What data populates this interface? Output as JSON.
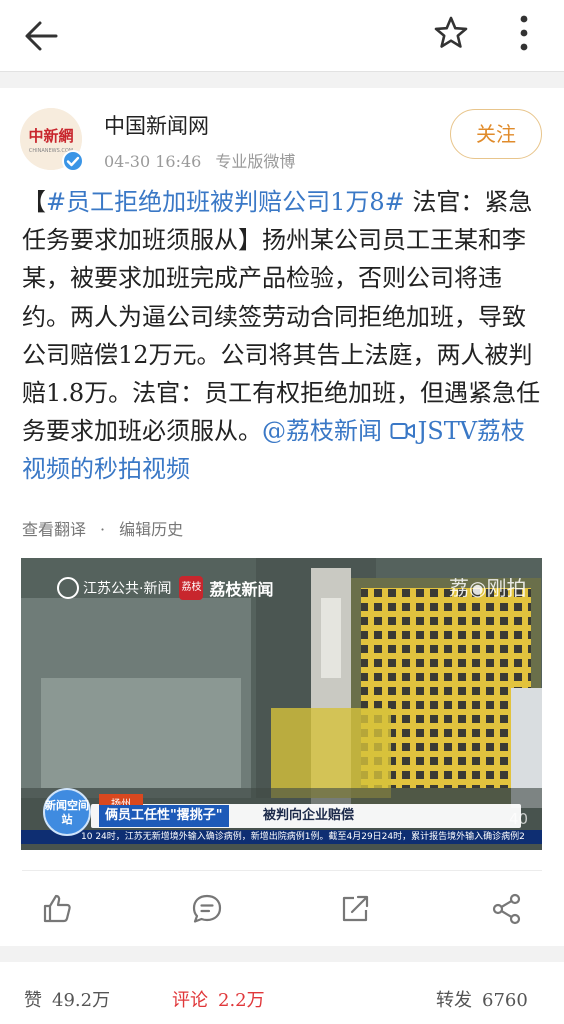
{
  "header": {
    "back_icon": "arrow-left-icon",
    "favorite_icon": "star-icon",
    "more_icon": "more-vertical-icon"
  },
  "post": {
    "author": "中国新闻网",
    "avatar_text": "中新網",
    "avatar_subtext": "CHINANEWS.COM",
    "timestamp": "04-30 16:46",
    "source": "专业版微博",
    "follow_label": "关注",
    "text_open": "【",
    "hashtag": "#员工拒绝加班被判赔公司1万8#",
    "text_body": " 法官：紧急任务要求加班须服从】扬州某公司员工王某和李某，被要求加班完成产品检验，否则公司将违约。两人为逼公司续签劳动合同拒绝加班，导致公司赔偿12万元。公司将其告上法庭，两人被判赔1.8万。法官：员工有权拒绝加班，但遇紧急任务要求加班必须服从。",
    "mention": "@荔枝新闻",
    "video_link": "JSTV荔枝视频的秒拍视频",
    "translate_label": "查看翻译",
    "separator": "·",
    "edit_history_label": "编辑历史"
  },
  "video": {
    "watermark_left": "江苏公共·新闻",
    "watermark_litchi_logo": "荔枝",
    "watermark_litchi": "荔枝新闻",
    "watermark_right": "荔◉刚拍",
    "badge": "新闻空间站",
    "lower_tag": "扬州",
    "lower_title": "俩员工任性\"撂挑子\"",
    "lower_title2": "被判向企业赔偿",
    "ticker": "10 24时，江苏无新增境外输入确诊病例，新增出院病例1例。截至4月29日24时，累计报告境外输入确诊病例2",
    "timecode": "40"
  },
  "actions": {
    "like_icon": "thumbs-up-icon",
    "comment_icon": "comment-icon",
    "repost_icon": "share-arrow-icon",
    "share_icon": "share-nodes-icon"
  },
  "stats": {
    "likes_label": "赞",
    "likes_count": "49.2万",
    "comments_label": "评论",
    "comments_count": "2.2万",
    "reposts_label": "转发",
    "reposts_count": "6760"
  },
  "colors": {
    "accent_link": "#3a78c6",
    "follow_text": "#e08b2b",
    "follow_border": "#e8c58c",
    "active_tab": "#e0373a",
    "verified": "#3a95e6"
  }
}
